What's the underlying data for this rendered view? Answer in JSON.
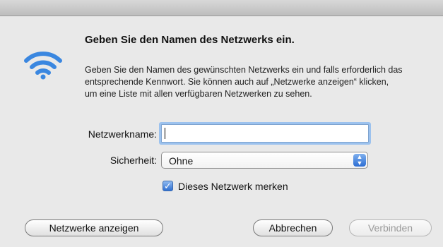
{
  "dialog": {
    "heading": "Geben Sie den Namen des Netzwerks ein.",
    "description": "Geben Sie den Namen des gewünschten Netzwerks ein und falls erforderlich das entsprechende Kennwort. Sie können auch auf „Netzwerke anzeigen“ klicken, um eine Liste mit allen verfügbaren Netzwerken zu sehen.",
    "icon": "wifi-icon"
  },
  "form": {
    "network_name_label": "Netzwerkname:",
    "network_name_value": "",
    "security_label": "Sicherheit:",
    "security_value": "Ohne",
    "remember_label": "Dieses Netzwerk merken",
    "remember_checked": true
  },
  "buttons": {
    "show_networks": "Netzwerke anzeigen",
    "cancel": "Abbrechen",
    "connect": "Verbinden"
  },
  "colors": {
    "accent": "#2d6ed4",
    "wifi": "#3a87e0",
    "focus_ring": "#9cc2ee"
  }
}
